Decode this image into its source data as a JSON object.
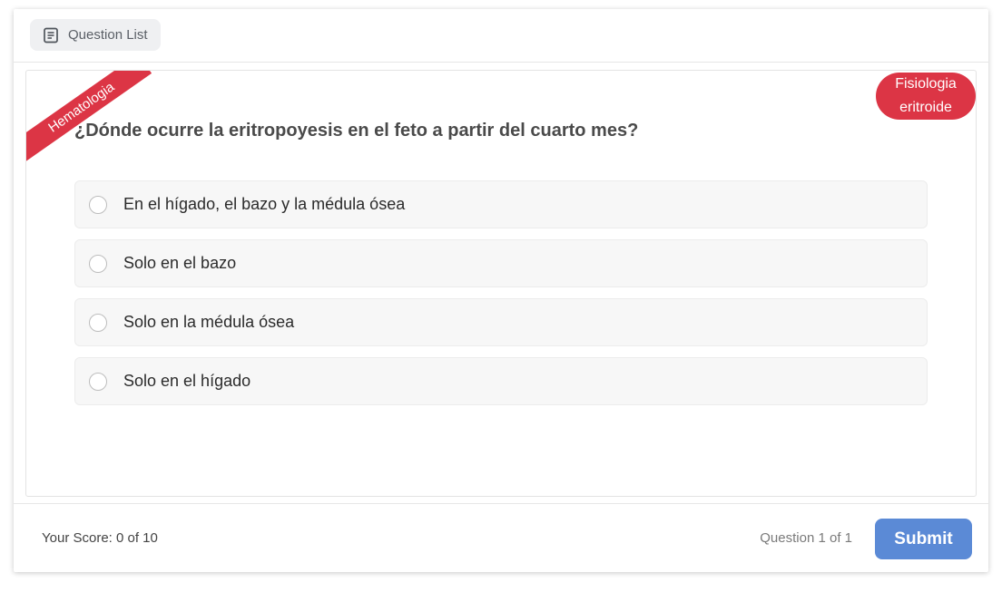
{
  "toolbar": {
    "question_list_label": "Question List",
    "question_list_icon": "document-list-icon"
  },
  "question": {
    "category": "Hematologia",
    "subtopic": "Fisiologia eritroide",
    "text": "¿Dónde ocurre la eritropoyesis en el feto a partir del cuarto mes?",
    "options": [
      {
        "label": "En el hígado, el bazo y la médula ósea"
      },
      {
        "label": "Solo en el bazo"
      },
      {
        "label": "Solo en la médula ósea"
      },
      {
        "label": "Solo en el hígado"
      }
    ]
  },
  "footer": {
    "score": "Your Score: 0 of 10",
    "progress": "Question 1 of 1",
    "submit_label": "Submit"
  },
  "colors": {
    "accent_red": "#dc3545",
    "submit_blue": "#5b8ad6"
  }
}
